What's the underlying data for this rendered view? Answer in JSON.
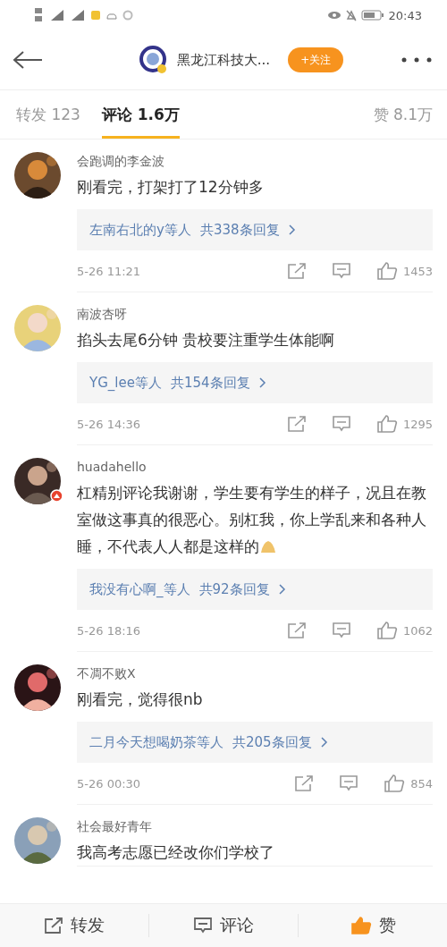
{
  "status_bar": {
    "time": "20:43"
  },
  "header": {
    "title": "黑龙江科技大...",
    "follow_button": "+关注"
  },
  "tabs": [
    {
      "label": "转发 123",
      "selected": false
    },
    {
      "label": "评论 1.6万",
      "selected": true
    },
    {
      "label": "赞 8.1万",
      "selected": false
    }
  ],
  "comments": [
    {
      "user": "会跑调的李金波",
      "text": "刚看完，打架打了12分钟多",
      "verified": false,
      "trailing_emoji": false,
      "replies_by": "左南右北的y等人",
      "reply_count": "共338条回复",
      "time": "5-26 11:21",
      "likes": "1453"
    },
    {
      "user": "南波杏呀",
      "text": "掐头去尾6分钟 贵校要注重学生体能啊",
      "verified": false,
      "trailing_emoji": false,
      "replies_by": "YG_lee等人",
      "reply_count": "共154条回复",
      "time": "5-26 14:36",
      "likes": "1295"
    },
    {
      "user": "huadahello",
      "text": "杠精别评论我谢谢，学生要有学生的样子，况且在教室做这事真的很恶心。别杠我，你上学乱来和各种人睡，不代表人人都是这样的",
      "verified": true,
      "trailing_emoji": true,
      "replies_by": "我没有心啊_等人",
      "reply_count": "共92条回复",
      "time": "5-26 18:16",
      "likes": "1062"
    },
    {
      "user": "不凋不败X",
      "text": "刚看完，觉得很nb",
      "verified": false,
      "trailing_emoji": false,
      "replies_by": "二月今天想喝奶茶等人",
      "reply_count": "共205条回复",
      "time": "5-26 00:30",
      "likes": "854"
    },
    {
      "user": "社会最好青年",
      "text": "我高考志愿已经改你们学校了",
      "verified": false,
      "trailing_emoji": false
    }
  ],
  "bottom_bar": [
    {
      "kind": "repost",
      "label": "转发",
      "active": false
    },
    {
      "kind": "comment",
      "label": "评论",
      "active": false
    },
    {
      "kind": "like",
      "label": "赞",
      "active": true
    }
  ]
}
